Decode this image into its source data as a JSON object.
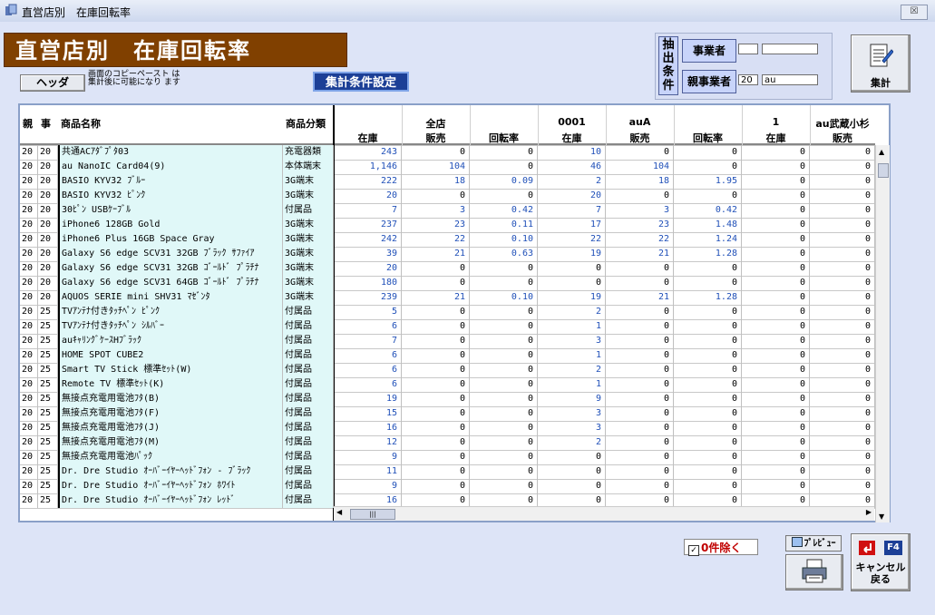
{
  "window": {
    "title": "直営店別　在庫回転率",
    "close_label": "☒"
  },
  "page_title": "直営店別　在庫回転率",
  "header_button": "ヘッダ",
  "header_note": "画面のコピーペースト は集計後に可能になり ます",
  "condition_button": "集計条件設定",
  "filter": {
    "tag": "抽出条件",
    "business_label": "事業者",
    "parent_label": "親事業者",
    "business_code": "",
    "business_name": "",
    "parent_code": "20",
    "parent_name": "au"
  },
  "aggregate_button": "集計",
  "grid": {
    "columns": [
      {
        "top": "",
        "bottom": "親"
      },
      {
        "top": "",
        "bottom": "事"
      },
      {
        "top": "",
        "bottom": "商品名称"
      },
      {
        "top": "",
        "bottom": "商品分類"
      },
      {
        "top": "",
        "bottom": "在庫"
      },
      {
        "top": "全店",
        "bottom": "販売"
      },
      {
        "top": "",
        "bottom": "回転率"
      },
      {
        "top": "0001",
        "bottom": "在庫"
      },
      {
        "top": "auA",
        "bottom": "販売"
      },
      {
        "top": "",
        "bottom": "回転率"
      },
      {
        "top": "1",
        "bottom": "在庫"
      },
      {
        "top": "au武蔵小杉",
        "bottom": "販売"
      }
    ],
    "rows": [
      [
        "20",
        "20",
        "共通ACｱﾀﾞﾌﾟﾀ03",
        "充電器類",
        "243",
        "0",
        "0",
        "10",
        "0",
        "0",
        "0",
        "0"
      ],
      [
        "20",
        "20",
        "au NanoIC Card04(9)",
        "本体端末",
        "1,146",
        "104",
        "0",
        "46",
        "104",
        "0",
        "0",
        "0"
      ],
      [
        "20",
        "20",
        "BASIO KYV32 ﾌﾞﾙｰ",
        "3G端末",
        "222",
        "18",
        "0.09",
        "2",
        "18",
        "1.95",
        "0",
        "0"
      ],
      [
        "20",
        "20",
        "BASIO KYV32 ﾋﾟﾝｸ",
        "3G端末",
        "20",
        "0",
        "0",
        "20",
        "0",
        "0",
        "0",
        "0"
      ],
      [
        "20",
        "20",
        "30ﾋﾟﾝ USBｹｰﾌﾞﾙ",
        "付属品",
        "7",
        "3",
        "0.42",
        "7",
        "3",
        "0.42",
        "0",
        "0"
      ],
      [
        "20",
        "20",
        "iPhone6 128GB Gold",
        "3G端末",
        "237",
        "23",
        "0.11",
        "17",
        "23",
        "1.48",
        "0",
        "0"
      ],
      [
        "20",
        "20",
        "iPhone6 Plus 16GB Space Gray",
        "3G端末",
        "242",
        "22",
        "0.10",
        "22",
        "22",
        "1.24",
        "0",
        "0"
      ],
      [
        "20",
        "20",
        "Galaxy S6 edge SCV31 32GB ﾌﾞﾗｯｸ ｻﾌｧｲｱ",
        "3G端末",
        "39",
        "21",
        "0.63",
        "19",
        "21",
        "1.28",
        "0",
        "0"
      ],
      [
        "20",
        "20",
        "Galaxy S6 edge SCV31 32GB ｺﾞｰﾙﾄﾞ ﾌﾟﾗﾁﾅ",
        "3G端末",
        "20",
        "0",
        "0",
        "0",
        "0",
        "0",
        "0",
        "0"
      ],
      [
        "20",
        "20",
        "Galaxy S6 edge SCV31 64GB ｺﾞｰﾙﾄﾞ ﾌﾟﾗﾁﾅ",
        "3G端末",
        "180",
        "0",
        "0",
        "0",
        "0",
        "0",
        "0",
        "0"
      ],
      [
        "20",
        "20",
        "AQUOS SERIE mini SHV31 ﾏｾﾞﾝﾀ",
        "3G端末",
        "239",
        "21",
        "0.10",
        "19",
        "21",
        "1.28",
        "0",
        "0"
      ],
      [
        "20",
        "25",
        "TVｱﾝﾃﾅ付きﾀｯﾁﾍﾟﾝ ﾋﾟﾝｸ",
        "付属品",
        "5",
        "0",
        "0",
        "2",
        "0",
        "0",
        "0",
        "0"
      ],
      [
        "20",
        "25",
        "TVｱﾝﾃﾅ付きﾀｯﾁﾍﾟﾝ ｼﾙﾊﾞｰ",
        "付属品",
        "6",
        "0",
        "0",
        "1",
        "0",
        "0",
        "0",
        "0"
      ],
      [
        "20",
        "25",
        "auｷｬﾘﾝｸﾞｹｰｽHﾌﾞﾗｯｸ",
        "付属品",
        "7",
        "0",
        "0",
        "3",
        "0",
        "0",
        "0",
        "0"
      ],
      [
        "20",
        "25",
        "HOME SPOT CUBE2",
        "付属品",
        "6",
        "0",
        "0",
        "1",
        "0",
        "0",
        "0",
        "0"
      ],
      [
        "20",
        "25",
        "Smart TV Stick 標準ｾｯﾄ(W)",
        "付属品",
        "6",
        "0",
        "0",
        "2",
        "0",
        "0",
        "0",
        "0"
      ],
      [
        "20",
        "25",
        "Remote TV 標準ｾｯﾄ(K)",
        "付属品",
        "6",
        "0",
        "0",
        "1",
        "0",
        "0",
        "0",
        "0"
      ],
      [
        "20",
        "25",
        "無接点充電用電池ﾌﾀ(B)",
        "付属品",
        "19",
        "0",
        "0",
        "9",
        "0",
        "0",
        "0",
        "0"
      ],
      [
        "20",
        "25",
        "無接点充電用電池ﾌﾀ(F)",
        "付属品",
        "15",
        "0",
        "0",
        "3",
        "0",
        "0",
        "0",
        "0"
      ],
      [
        "20",
        "25",
        "無接点充電用電池ﾌﾀ(J)",
        "付属品",
        "16",
        "0",
        "0",
        "3",
        "0",
        "0",
        "0",
        "0"
      ],
      [
        "20",
        "25",
        "無接点充電用電池ﾌﾀ(M)",
        "付属品",
        "12",
        "0",
        "0",
        "2",
        "0",
        "0",
        "0",
        "0"
      ],
      [
        "20",
        "25",
        "無接点充電用電池ﾊﾟｯｸ",
        "付属品",
        "9",
        "0",
        "0",
        "0",
        "0",
        "0",
        "0",
        "0"
      ],
      [
        "20",
        "25",
        "Dr. Dre Studio ｵｰﾊﾞｰｲﾔｰﾍｯﾄﾞﾌｫﾝ - ﾌﾞﾗｯｸ",
        "付属品",
        "11",
        "0",
        "0",
        "0",
        "0",
        "0",
        "0",
        "0"
      ],
      [
        "20",
        "25",
        "Dr. Dre Studio ｵｰﾊﾞｰｲﾔｰﾍｯﾄﾞﾌｫﾝ ﾎﾜｲﾄ",
        "付属品",
        "9",
        "0",
        "0",
        "0",
        "0",
        "0",
        "0",
        "0"
      ],
      [
        "20",
        "25",
        "Dr. Dre Studio ｵｰﾊﾞｰｲﾔｰﾍｯﾄﾞﾌｫﾝ ﾚｯﾄﾞ",
        "付属品",
        "16",
        "0",
        "0",
        "0",
        "0",
        "0",
        "0",
        "0"
      ]
    ]
  },
  "exclude_zero": {
    "label": "0件除く",
    "checked": true
  },
  "preview_button": "ﾌﾟﾚﾋﾞｭｰ",
  "cancel": {
    "key": "F4",
    "line1": "キャンセル",
    "line2": "戻る"
  },
  "colors": {
    "brand": "#804000",
    "accent": "#1c3f96",
    "value_blue": "#2050b8",
    "label_red": "#c00000"
  }
}
